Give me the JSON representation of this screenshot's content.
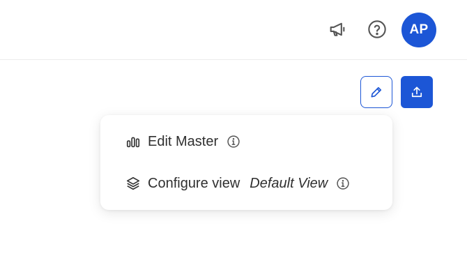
{
  "header": {
    "announcement_icon": "megaphone-icon",
    "help_icon": "question-circle-icon",
    "avatar_initials": "AP"
  },
  "toolbar": {
    "edit_icon": "pencil-icon",
    "export_icon": "upload-icon"
  },
  "menu": {
    "items": [
      {
        "label": "Edit Master",
        "icon": "bar-chart-icon",
        "info_icon": "info-icon"
      },
      {
        "label": "Configure view",
        "value": "Default View",
        "icon": "layers-icon",
        "info_icon": "info-icon"
      }
    ]
  },
  "colors": {
    "accent": "#1c56d6",
    "text": "#2f2f2f",
    "icon": "#555555",
    "divider": "#ececec"
  }
}
